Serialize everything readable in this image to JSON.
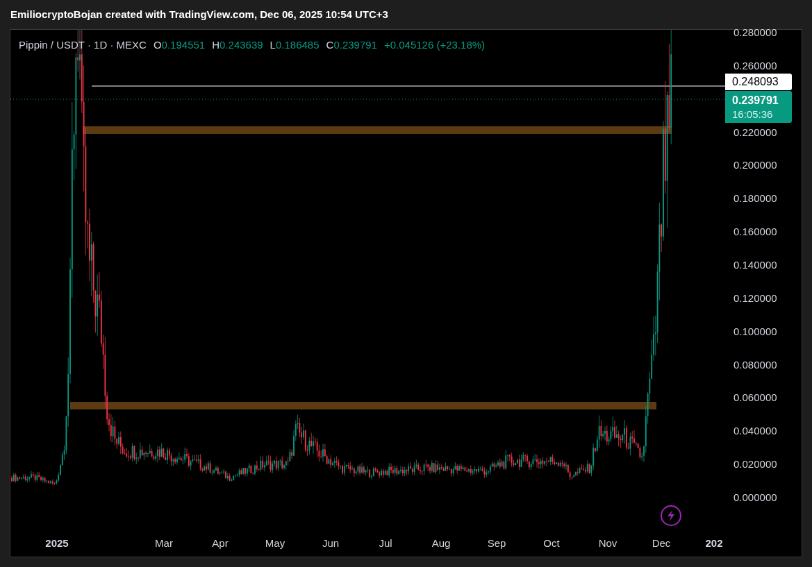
{
  "header": {
    "text": "EmiliocryptoBojan created with TradingView.com, Dec 06, 2025 10:54 UTC+3"
  },
  "legend": {
    "symbol": "Pippin / USDT · 1D · MEXC",
    "ohlc": [
      {
        "label": "O",
        "value": "0.194551"
      },
      {
        "label": "H",
        "value": "0.243639"
      },
      {
        "label": "L",
        "value": "0.186485"
      },
      {
        "label": "C",
        "value": "0.239791"
      }
    ],
    "change": "+0.045126 (+23.18%)"
  },
  "price_axis": [
    "0.280000",
    "0.260000",
    "0.220000",
    "0.200000",
    "0.180000",
    "0.160000",
    "0.140000",
    "0.120000",
    "0.100000",
    "0.080000",
    "0.060000",
    "0.040000",
    "0.020000",
    "0.000000"
  ],
  "price_tags": [
    {
      "kind": "line",
      "price": "0.248093"
    },
    {
      "kind": "last",
      "price": "0.239791",
      "countdown": "16:05:36"
    }
  ],
  "time_axis": [
    {
      "label": "2025",
      "kind": "year"
    },
    {
      "label": "Mar",
      "kind": "month"
    },
    {
      "label": "Apr",
      "kind": "month"
    },
    {
      "label": "May",
      "kind": "month"
    },
    {
      "label": "Jun",
      "kind": "month"
    },
    {
      "label": "Jul",
      "kind": "month"
    },
    {
      "label": "Aug",
      "kind": "month"
    },
    {
      "label": "Sep",
      "kind": "month"
    },
    {
      "label": "Oct",
      "kind": "month"
    },
    {
      "label": "Nov",
      "kind": "month"
    },
    {
      "label": "Dec",
      "kind": "month"
    },
    {
      "label": "202",
      "kind": "year"
    }
  ]
}
